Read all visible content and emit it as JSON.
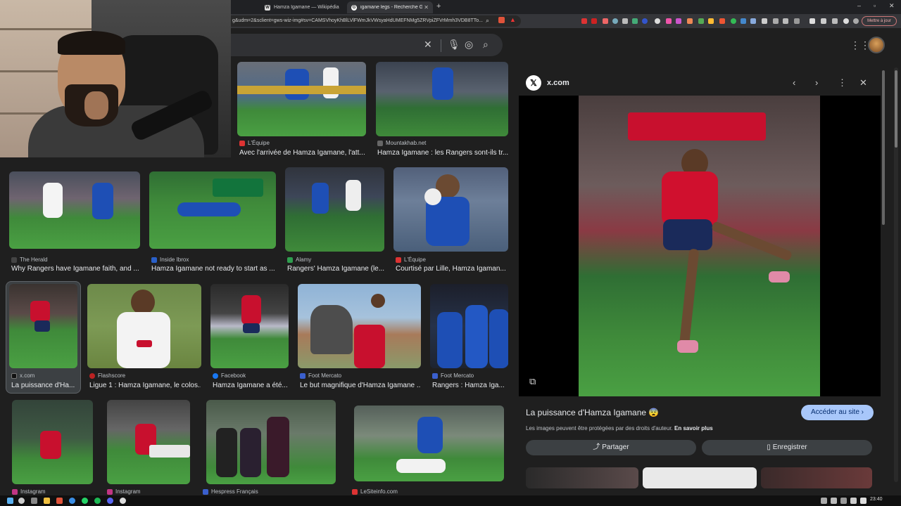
{
  "browser": {
    "tabs": [
      {
        "label": "Hamza Igamane — Wikipédia",
        "favicon": "W"
      },
      {
        "label": "igamane legs - Recherche Google",
        "favicon": "G"
      }
    ],
    "url": "g&udm=2&sclient=gws-wiz-img#sv=CAMSVhoyKhBlLVlFWmJkVWsyaHdUMEFNMg5ZRVpiZFVrMmh3VDB8TTo...",
    "update_button": "Mettre à jour"
  },
  "results": [
    {
      "source": "L'Équipe",
      "title": "Avec l'arrivée de Hamza Igamane, l'att...",
      "icon_color": "#d33"
    },
    {
      "source": "Mountakhab.net",
      "title": "Hamza Igamane : les Rangers sont-ils tr...",
      "icon_color": "#666"
    },
    {
      "source": "The Herald",
      "title": "Why Rangers have Igamane faith, and ...",
      "icon_color": "#444"
    },
    {
      "source": "Inside Ibrox",
      "title": "Hamza Igamane not ready to start as ...",
      "icon_color": "#2a60c9"
    },
    {
      "source": "Alamy",
      "title": "Rangers' Hamza Igamane (le...",
      "icon_color": "#2f9e4f"
    },
    {
      "source": "L'Équipe",
      "title": "Courtisé par Lille, Hamza Igaman...",
      "icon_color": "#d33"
    },
    {
      "source": "x.com",
      "title": "La puissance d'Ha...",
      "icon_color": "#111"
    },
    {
      "source": "Flashscore",
      "title": "Ligue 1 : Hamza Igamane, le colos...",
      "icon_color": "#b22"
    },
    {
      "source": "Facebook",
      "title": "Hamza Igamane a été...",
      "icon_color": "#1877f2"
    },
    {
      "source": "Foot Mercato",
      "title": "Le but magnifique d'Hamza Igamane ...",
      "icon_color": "#3a5fcd"
    },
    {
      "source": "Foot Mercato",
      "title": "Rangers : Hamza Iga...",
      "icon_color": "#3a5fcd"
    },
    {
      "source": "Instagram",
      "title": "",
      "icon_color": "#c13584"
    },
    {
      "source": "Instagram",
      "title": "",
      "icon_color": "#c13584"
    },
    {
      "source": "Hespress Français",
      "title": "",
      "icon_color": "#3a5fcd"
    },
    {
      "source": "LeSiteinfo.com",
      "title": "",
      "icon_color": "#d33"
    }
  ],
  "panel": {
    "source": "x.com",
    "title": "La puissance d'Hamza Igamane 😨",
    "visit_button": "Accéder au site ›",
    "copyright": "Les images peuvent être protégées par des droits d'auteur.",
    "learn_more": "En savoir plus",
    "share_button": "Partager",
    "save_button": "Enregistrer"
  },
  "taskbar": {
    "time": "23:40"
  },
  "colors": {
    "rangers_blue": "#1e4fb5",
    "lille_red": "#c8102e",
    "pitch_green": "#3f8a3a"
  }
}
